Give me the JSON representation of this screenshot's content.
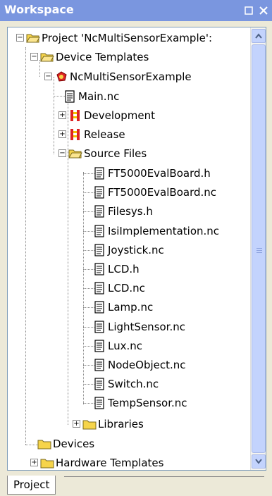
{
  "window": {
    "title": "Workspace",
    "close_glyph": "✕",
    "restore_glyph": "□"
  },
  "tree": {
    "root": {
      "label": "Project 'NcMultiSensorExample':",
      "icon": "folder-open-icon"
    },
    "device_templates": {
      "label": "Device Templates",
      "icon": "folder-open-icon"
    },
    "ncmulti": {
      "label": "NcMultiSensorExample",
      "icon": "device-template-icon"
    },
    "main_nc": {
      "label": "Main.nc",
      "icon": "file-icon"
    },
    "development": {
      "label": "Development",
      "icon": "build-config-icon"
    },
    "release": {
      "label": "Release",
      "icon": "build-config-icon"
    },
    "source_files": {
      "label": "Source Files",
      "icon": "folder-open-icon"
    },
    "source_items": [
      {
        "label": "FT5000EvalBoard.h"
      },
      {
        "label": "FT5000EvalBoard.nc"
      },
      {
        "label": "Filesys.h"
      },
      {
        "label": "IsiImplementation.nc"
      },
      {
        "label": "Joystick.nc"
      },
      {
        "label": "LCD.h"
      },
      {
        "label": "LCD.nc"
      },
      {
        "label": "Lamp.nc"
      },
      {
        "label": "LightSensor.nc"
      },
      {
        "label": "Lux.nc"
      },
      {
        "label": "NodeObject.nc"
      },
      {
        "label": "Switch.nc"
      },
      {
        "label": "TempSensor.nc"
      }
    ],
    "libraries": {
      "label": "Libraries",
      "icon": "folder-closed-icon"
    },
    "devices": {
      "label": "Devices",
      "icon": "folder-closed-icon"
    },
    "hardware_templates": {
      "label": "Hardware Templates",
      "icon": "folder-closed-icon"
    }
  },
  "tabs": [
    {
      "label": "Project",
      "selected": true
    }
  ],
  "colors": {
    "titlebar": "#7a96df",
    "folder": "#f6d44a",
    "scroll": "#c3d3fd"
  }
}
